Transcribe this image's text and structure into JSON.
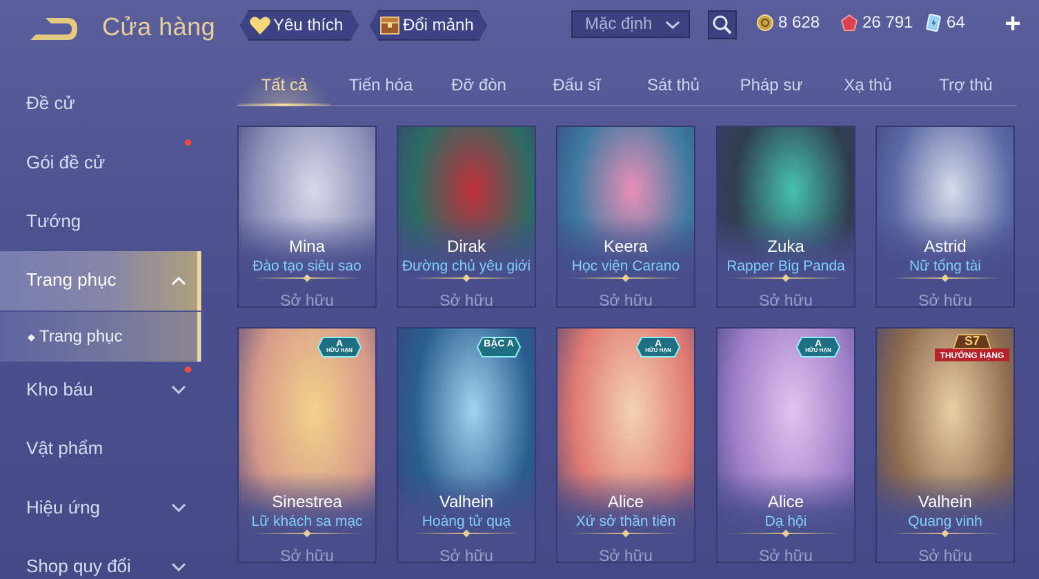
{
  "header": {
    "title": "Cửa hàng",
    "favorite_label": "Yêu thích",
    "exchange_label": "Đổi mảnh",
    "sort_selected": "Mặc định",
    "currencies": [
      {
        "icon": "gold-coin-icon",
        "value": "8 628"
      },
      {
        "icon": "ruby-voucher-icon",
        "value": "26 791"
      },
      {
        "icon": "card-ticket-icon",
        "value": "64"
      }
    ],
    "plus_label": "+"
  },
  "sidebar": {
    "items": [
      {
        "label": "Đề cử"
      },
      {
        "label": "Gói đề cử"
      },
      {
        "label": "Tướng"
      },
      {
        "label": "Trang phục"
      },
      {
        "label": "Trang phục"
      },
      {
        "label": "Kho báu"
      },
      {
        "label": "Vật phẩm"
      },
      {
        "label": "Hiệu ứng"
      },
      {
        "label": "Shop quy đổi"
      }
    ]
  },
  "tabs": [
    {
      "label": "Tất cả"
    },
    {
      "label": "Tiến hóa"
    },
    {
      "label": "Đỡ đòn"
    },
    {
      "label": "Đấu sĩ"
    },
    {
      "label": "Sát thủ"
    },
    {
      "label": "Pháp sư"
    },
    {
      "label": "Xạ thủ"
    },
    {
      "label": "Trợ thủ"
    }
  ],
  "cards": [
    {
      "hero": "Mina",
      "skin": "Đào tạo siêu sao",
      "status": "Sở hữu",
      "colors": [
        "#8e8eb8",
        "#d9d9ea"
      ]
    },
    {
      "hero": "Dirak",
      "skin": "Đường chủ yêu giới",
      "status": "Sở hữu",
      "colors": [
        "#2c6b63",
        "#c0303a"
      ]
    },
    {
      "hero": "Keera",
      "skin": "Học viện Carano",
      "status": "Sở hữu",
      "colors": [
        "#3c7aa0",
        "#e98fb8"
      ]
    },
    {
      "hero": "Zuka",
      "skin": "Rapper Big Panda",
      "status": "Sở hữu",
      "colors": [
        "#2f3e4e",
        "#46c2b0"
      ]
    },
    {
      "hero": "Astrid",
      "skin": "Nữ tổng tài",
      "status": "Sở hữu",
      "colors": [
        "#5b6aa6",
        "#d8dbea"
      ]
    },
    {
      "hero": "Sinestrea",
      "skin": "Lữ khách sa mạc",
      "status": "Sở hữu",
      "colors": [
        "#d79a8a",
        "#f1d28a"
      ],
      "badge": {
        "top": "A",
        "bottom": "HỮU HẠN"
      }
    },
    {
      "hero": "Valhein",
      "skin": "Hoàng tử quạ",
      "status": "Sở hữu",
      "colors": [
        "#2a5e8f",
        "#9fd3ef"
      ],
      "badge": {
        "top": "BẬC A",
        "bottom": ""
      }
    },
    {
      "hero": "Alice",
      "skin": "Xứ sở thần tiên",
      "status": "Sở hữu",
      "colors": [
        "#e07a72",
        "#f3d2b5"
      ],
      "badge": {
        "top": "A",
        "bottom": "HỮU HẠN"
      }
    },
    {
      "hero": "Alice",
      "skin": "Dạ hội",
      "status": "Sở hữu",
      "colors": [
        "#9f7fc9",
        "#e5c1ee"
      ],
      "badge": {
        "top": "A",
        "bottom": "HỮU HẠN"
      }
    },
    {
      "hero": "Valhein",
      "skin": "Quang vinh",
      "status": "Sở hữu",
      "colors": [
        "#8e6b4e",
        "#e9cfa4"
      ],
      "badge": {
        "top": "S7",
        "bottom": "THƯỞNG HẠNG"
      }
    }
  ]
}
